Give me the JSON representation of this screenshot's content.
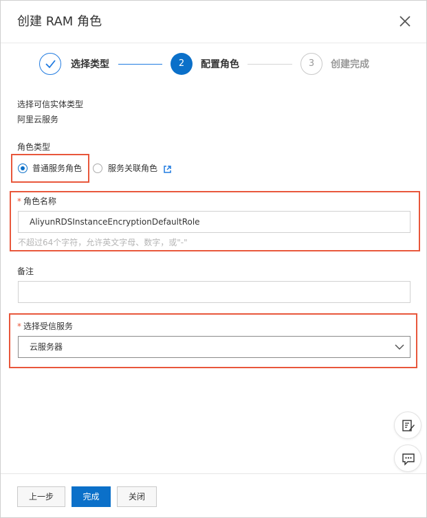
{
  "dialog": {
    "title": "创建 RAM 角色"
  },
  "steps": [
    {
      "label": "选择类型",
      "state": "done"
    },
    {
      "number": "2",
      "label": "配置角色",
      "state": "active"
    },
    {
      "number": "3",
      "label": "创建完成",
      "state": "pending"
    }
  ],
  "entity": {
    "label": "选择可信实体类型",
    "value": "阿里云服务"
  },
  "role_type": {
    "label": "角色类型",
    "options": [
      {
        "label": "普通服务角色",
        "selected": true
      },
      {
        "label": "服务关联角色",
        "selected": false
      }
    ]
  },
  "role_name": {
    "required_mark": "*",
    "label": "角色名称",
    "value": "AliyunRDSInstanceEncryptionDefaultRole",
    "hint": "不超过64个字符，允许英文字母、数字，或\"-\""
  },
  "note": {
    "label": "备注",
    "value": ""
  },
  "trusted_service": {
    "required_mark": "*",
    "label": "选择受信服务",
    "value": "云服务器"
  },
  "footer": {
    "prev_label": "上一步",
    "done_label": "完成",
    "close_label": "关闭"
  },
  "colors": {
    "primary": "#0b70c9",
    "highlight": "#e8563a"
  }
}
